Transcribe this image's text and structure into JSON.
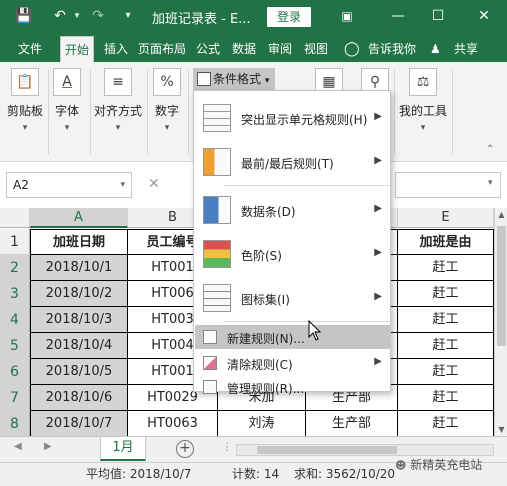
{
  "window": {
    "title": "加班记录表 - E...",
    "login_label": "登录"
  },
  "ribbon_tabs": [
    {
      "label": "文件"
    },
    {
      "label": "开始"
    },
    {
      "label": "插入"
    },
    {
      "label": "页面布局"
    },
    {
      "label": "公式"
    },
    {
      "label": "数据"
    },
    {
      "label": "审阅"
    },
    {
      "label": "视图"
    },
    {
      "label": "告诉我你"
    },
    {
      "label": "共享"
    }
  ],
  "ribbon_groups": [
    {
      "label": "剪贴板",
      "icon": "clipboard-icon"
    },
    {
      "label": "字体",
      "icon": "font-color-icon"
    },
    {
      "label": "对齐方式",
      "icon": "align-icon"
    },
    {
      "label": "数字",
      "icon": "percent-icon"
    },
    {
      "label": "我的工具",
      "icon": "scale-icon"
    }
  ],
  "conditional_format_label": "条件格式",
  "formula_bar": {
    "name_box": "A2"
  },
  "columns": [
    "A",
    "B",
    "E"
  ],
  "rows": [
    "1",
    "2",
    "3",
    "4",
    "5",
    "6",
    "7",
    "8"
  ],
  "table": {
    "headers": {
      "a": "加班日期",
      "b": "员工编号",
      "e": "加班是由"
    },
    "rows": [
      {
        "a": "2018/10/1",
        "b": "HT001",
        "c": "",
        "d": "",
        "e": "赶工"
      },
      {
        "a": "2018/10/2",
        "b": "HT006",
        "c": "",
        "d": "",
        "e": "赶工"
      },
      {
        "a": "2018/10/3",
        "b": "HT003",
        "c": "",
        "d": "",
        "e": "赶工"
      },
      {
        "a": "2018/10/4",
        "b": "HT004",
        "c": "",
        "d": "",
        "e": "赶工"
      },
      {
        "a": "2018/10/5",
        "b": "HT001",
        "c": "",
        "d": "",
        "e": "赶工"
      },
      {
        "a": "2018/10/6",
        "b": "HT0029",
        "c": "宋加",
        "d": "生产部",
        "e": "赶工"
      },
      {
        "a": "2018/10/7",
        "b": "HT0063",
        "c": "刘涛",
        "d": "生产部",
        "e": "赶工"
      }
    ]
  },
  "menu": {
    "items": [
      {
        "label": "突出显示单元格规则(H)",
        "icon": "highlight-rules-icon",
        "has_submenu": true
      },
      {
        "label": "最前/最后规则(T)",
        "icon": "top-bottom-icon",
        "has_submenu": true
      },
      {
        "label": "数据条(D)",
        "icon": "data-bars-icon",
        "has_submenu": true
      },
      {
        "label": "色阶(S)",
        "icon": "color-scales-icon",
        "has_submenu": true
      },
      {
        "label": "图标集(I)",
        "icon": "icon-sets-icon",
        "has_submenu": true
      },
      {
        "label": "新建规则(N)...",
        "icon": "new-rule-icon",
        "has_submenu": false
      },
      {
        "label": "清除规则(C)",
        "icon": "clear-rules-icon",
        "has_submenu": true
      },
      {
        "label": "管理规则(R)...",
        "icon": "manage-rules-icon",
        "has_submenu": false
      }
    ]
  },
  "sheet_tab": "1月",
  "status": {
    "average": "平均值: 2018/10/7",
    "count": "计数: 14",
    "sum": "求和: 3562/10/20"
  },
  "watermark": "新精英充电站",
  "colors": {
    "accent": "#217346",
    "selection": "#d4d4d4",
    "menu_hover": "#c5c5c5"
  }
}
